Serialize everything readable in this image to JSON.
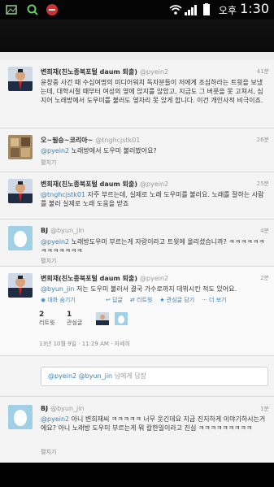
{
  "status_bar": {
    "ampm": "오후",
    "time": "1:30",
    "icons": [
      "gallery-icon",
      "search-icon",
      "stop-icon",
      "wifi-icon",
      "signal-icon",
      "battery-icon"
    ]
  },
  "tweets": [
    {
      "name": "변희재(친노종북포털 daum 퇴출)",
      "handle": "@pyein2",
      "time": "41분",
      "text": "윤창중 사건 때 수십여명의 미디어워치 독자분들이 저에게 조심하라는 트윗을 보냈는데, 대학시절 때부터 여성의 옆에 앉지를 않았고, 지금도 그 버릇을 못 고쳐서, 심지어 노래방에서 도우미를 불러도 옆자리 못 앉게 합니다. 이건 개인사적 비극이죠.",
      "expand": ""
    },
    {
      "name": "오~필승~코리아~",
      "handle": "@tnghcjstk01",
      "time": "26분",
      "mention": "@pyein2",
      "text": " 노래방에서 도우미 불러봤어요?",
      "expand": "펼치기"
    },
    {
      "name": "변희재(친노종북포털 daum 퇴출)",
      "handle": "@pyein2",
      "time": "25분",
      "mention": "@tnghcjstk01",
      "text": " 자주 부르는데, 실제로 노래 도우미를 불러요. 노래를 잘하는 사람를 불러 실제로 노래 도움을 받죠",
      "expand": ""
    },
    {
      "name": "BJ",
      "handle": "@byun_jin",
      "time": "4분",
      "mention": "@pyein2",
      "text": " 노래방도우미 부르는게 자랑이라고 트윗에 올리셨습니까? ㅋㅋㅋㅋㅋㅋㅋㅋㅋㅋㅋㅋㅋ",
      "expand": "펼치기"
    }
  ],
  "detail": {
    "name": "변희재(친노종북포털 daum 퇴출)",
    "handle": "@pyein2",
    "time": "2분",
    "mention": "@byun_jin",
    "text": " 저는 도우미 불러서 결국 가수로까지 데뷔시킨 적도 있어요.",
    "conversation": "대화 숨기기",
    "actions": [
      "답글",
      "리트윗",
      "관심글 담기",
      "더 보기"
    ],
    "retweets_count": "2",
    "retweets_label": "리트윗",
    "favorites_count": "1",
    "favorites_label": "관심글",
    "timestamp": "13년 10월 9일 · 11:29 AM · 자세히"
  },
  "reply_box": {
    "prefix": "@pyein2 @byun_jin",
    "placeholder": "님에게 답장"
  },
  "last_tweet": {
    "name": "BJ",
    "handle": "@byun_jin",
    "time": "1분",
    "mention": "@pyein2",
    "text": " 아니 변희재씨 ㅋㅋㅋㅋㅋ 너무 웃긴데요 지금 진지하게 이야기하시는거에요? 아니 노래방 도우미 부르는게 뭐 칼한일이라고 진심 ㅋㅋㅋㅋㅋㅋㅋㅋㅋ",
    "expand": "펼치기"
  },
  "colors": {
    "accent": "#3b82b8",
    "background": "#ececec"
  }
}
